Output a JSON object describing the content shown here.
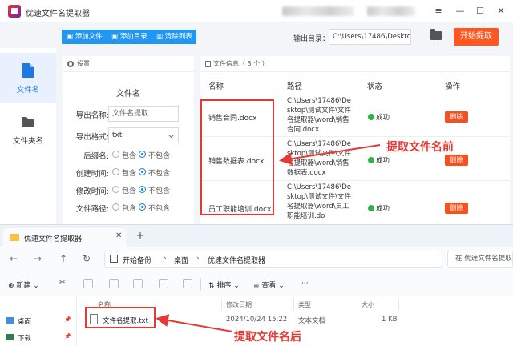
{
  "app": {
    "title": "优速文件名提取器",
    "window_controls": [
      "≡",
      "—",
      "☐",
      "✕"
    ],
    "sidebar": [
      {
        "label": "文件名",
        "icon": "file-icon",
        "active": true
      },
      {
        "label": "文件夹名",
        "icon": "folder-icon",
        "active": false
      }
    ],
    "toolbar": {
      "add_file": "添加文件",
      "add_folder": "添加目录",
      "clear_list": "清除列表"
    },
    "output": {
      "label": "输出目录：",
      "path": "C:\\Users\\17486\\Deskto",
      "start_button": "开始提取"
    },
    "settings": {
      "header": "设置",
      "title": "文件名",
      "export_name_label": "导出名称:",
      "export_name_placeholder": "文件名提取",
      "export_format_label": "导出格式:",
      "export_format_value": "txt",
      "include_option": "包含",
      "exclude_option": "不包含",
      "rows": [
        {
          "label": "后缀名:",
          "selected": "exclude"
        },
        {
          "label": "创建时间:",
          "selected": "exclude"
        },
        {
          "label": "修改时间:",
          "selected": "exclude"
        },
        {
          "label": "文件路径:",
          "selected": "exclude"
        }
      ]
    },
    "files": {
      "header": "文件信息（ 3 个 ）",
      "columns": [
        "名称",
        "路径",
        "状态",
        "操作"
      ],
      "rows": [
        {
          "name": "销售合同.docx",
          "path": "C:\\Users\\17486\\Desktop\\测试文件\\文件名提取器\\word\\销售合同.docx",
          "status": "成功",
          "action": "删除"
        },
        {
          "name": "销售数据表.docx",
          "path": "C:\\Users\\17486\\Desktop\\测试文件\\文件名提取器\\word\\销售数据表.docx",
          "status": "成功",
          "action": "删除"
        },
        {
          "name": "员工职能培训.docx",
          "path": "C:\\Users\\17486\\Desktop\\测试文件\\文件名提取器\\word\\员工职能培训.do",
          "status": "成功",
          "action": "删除"
        }
      ]
    }
  },
  "explorer": {
    "tab_title": "优速文件名提取器",
    "tab_close": "✕",
    "new_tab": "+",
    "breadcrumb": [
      "开始备份",
      "桌面",
      "优速文件名提取器"
    ],
    "search_placeholder": "在 优速文件名提取",
    "commands": {
      "new": "新建",
      "sort": "排序",
      "view": "查看",
      "more": "···"
    },
    "nav_pane": [
      {
        "label": "桌面"
      },
      {
        "label": "下载"
      }
    ],
    "columns": [
      "名称",
      "修改日期",
      "类型",
      "大小"
    ],
    "file": {
      "name": "文件名提取.txt",
      "modified": "2024/10/24 15:22",
      "type": "文本文档",
      "size": "1 KB"
    }
  },
  "annotations": {
    "before": "提取文件名前",
    "after": "提取文件名后"
  },
  "colors": {
    "accent_blue": "#2196f3",
    "start_orange": "#ff5722",
    "delete_red": "#f4511e",
    "success_green": "#2fb344",
    "annotation_red": "#e53935"
  }
}
